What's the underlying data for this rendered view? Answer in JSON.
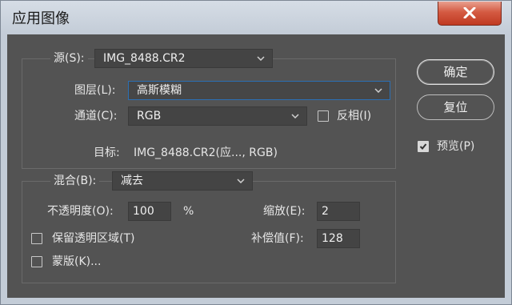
{
  "window": {
    "title": "应用图像"
  },
  "source": {
    "label": "源(S):",
    "value": "IMG_8488.CR2"
  },
  "layer": {
    "label": "图层(L):",
    "value": "高斯模糊"
  },
  "channel": {
    "label": "通道(C):",
    "value": "RGB",
    "invert_label": "反相(I)",
    "invert_checked": false
  },
  "target": {
    "label": "目标:",
    "value": "IMG_8488.CR2(应..., RGB)"
  },
  "blending": {
    "label": "混合(B):",
    "value": "减去"
  },
  "opacity": {
    "label": "不透明度(O):",
    "value": "100",
    "unit": "%"
  },
  "scale": {
    "label": "缩放(E):",
    "value": "2"
  },
  "offset": {
    "label": "补偿值(F):",
    "value": "128"
  },
  "preserve_transparency": {
    "label": "保留透明区域(T)",
    "checked": false
  },
  "mask": {
    "label": "蒙版(K)...",
    "checked": false
  },
  "buttons": {
    "ok": "确定",
    "reset": "复位"
  },
  "preview": {
    "label": "预览(P)",
    "checked": true
  },
  "colors": {
    "panel": "#535353",
    "field": "#444444",
    "focus": "#2b6fb4",
    "close": "#c9452c"
  },
  "icons": {
    "close": "close-icon",
    "dropdown": "chevron-down-icon",
    "check": "checkmark-icon"
  }
}
